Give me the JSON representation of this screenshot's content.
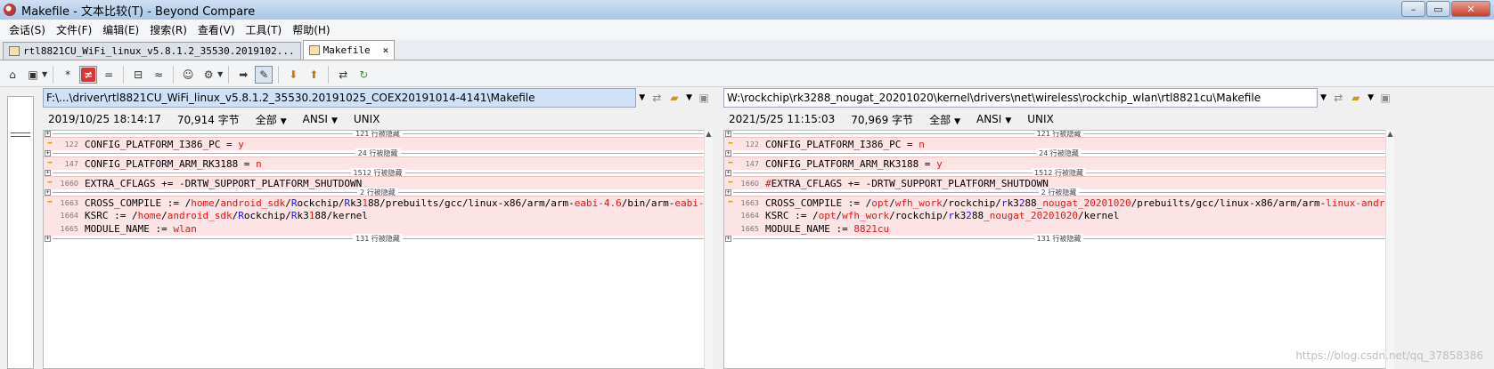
{
  "window": {
    "title": "Makefile - 文本比较(T) - Beyond Compare",
    "controls": {
      "minimize": "–",
      "maximize": "▭",
      "close": "✕"
    }
  },
  "menu": [
    "会话(S)",
    "文件(F)",
    "编辑(E)",
    "搜索(R)",
    "查看(V)",
    "工具(T)",
    "帮助(H)"
  ],
  "tabs": [
    {
      "label": "rtl8821CU_WiFi_linux_v5.8.1.2_35530.2019102...",
      "active": false
    },
    {
      "label": "Makefile",
      "active": true,
      "close": "×"
    }
  ],
  "toolbar": {
    "icons": [
      "home-icon",
      "briefcase-icon",
      "star-icon",
      "not-equal-icon",
      "equal-icon",
      "minor-diff-icon",
      "approx-icon",
      "user-icon",
      "rules-icon",
      "next-icon",
      "edit-icon",
      "down-arrow-icon",
      "up-arrow-icon",
      "swap-icon",
      "refresh-icon"
    ],
    "glyphs": {
      "home": "⌂",
      "briefcase": "▣",
      "star": "*",
      "neq": "≠",
      "eq": "=",
      "minor": "⊟",
      "approx": "≈",
      "user": "☺",
      "rules": "⚙",
      "next": "➡",
      "edit": "✎",
      "down": "⬇",
      "up": "⬆",
      "swap": "⇄",
      "refresh": "↻",
      "drop": "▼"
    }
  },
  "left": {
    "path": "F:\\...\\driver\\rtl8821CU_WiFi_linux_v5.8.1.2_35530.20191025_COEX20191014-4141\\Makefile",
    "date": "2019/10/25 18:14:17",
    "size": "70,914 字节",
    "lines_opt": "全部",
    "encoding": "ANSI",
    "eol": "UNIX"
  },
  "right": {
    "path": "W:\\rockchip\\rk3288_nougat_20201020\\kernel\\drivers\\net\\wireless\\rockchip_wlan\\rtl8821cu\\Makefile",
    "date": "2021/5/25 11:15:03",
    "size": "70,969 字节",
    "lines_opt": "全部",
    "encoding": "ANSI",
    "eol": "UNIX"
  },
  "separators": [
    "121 行被隐藏",
    "24 行被隐藏",
    "1512 行被隐藏",
    "2 行被隐藏",
    "131 行被隐藏"
  ],
  "lines": {
    "l122": "122",
    "l147": "147",
    "l1660": "1660",
    "l1663": "1663",
    "l1664": "1664",
    "l1665": "1665",
    "left": {
      "c122a": "CONFIG_PLATFORM_I386_PC = ",
      "c122b": "y",
      "c147a": "CONFIG_PLATFORM_ARM_RK3188 = ",
      "c147b": "n",
      "c1660": "EXTRA_CFLAGS += -DRTW_SUPPORT_PLATFORM_SHUTDOWN",
      "c1663a": "CROSS_COMPILE := /",
      "c1663b": "home",
      "c1663c": "/",
      "c1663d": "android_sdk",
      "c1663e": "/",
      "c1663f": "R",
      "c1663g": "ockchip/",
      "c1663h": "R",
      "c1663i": "k3",
      "c1663j": "1",
      "c1663k": "88/prebuilts/gcc/linux-x86/arm/arm-",
      "c1663l": "eabi-4.6",
      "c1663m": "/bin/arm-",
      "c1663n": "eabi-",
      "c1664a": "KSRC := /",
      "c1664b": "home",
      "c1664c": "/",
      "c1664d": "android_sdk",
      "c1664e": "/",
      "c1664f": "R",
      "c1664g": "ockchip/",
      "c1664h": "R",
      "c1664i": "k3",
      "c1664j": "1",
      "c1664k": "88/kernel",
      "c1665a": "MODULE_NAME := ",
      "c1665b": "wlan"
    },
    "right": {
      "c122a": "CONFIG_PLATFORM_I386_PC = ",
      "c122b": "n",
      "c147a": "CONFIG_PLATFORM_ARM_RK3188 = ",
      "c147b": "y",
      "c1660a": "#",
      "c1660b": "EXTRA_CFLAGS += -DRTW_SUPPORT_PLATFORM_SHUTDOWN",
      "c1663a": "CROSS_COMPILE := /",
      "c1663b": "opt",
      "c1663c": "/",
      "c1663d": "wfh_work",
      "c1663e": "/rockchip/",
      "c1663f": "r",
      "c1663g": "k3",
      "c1663h": "2",
      "c1663i": "88_",
      "c1663j": "nougat_20201020",
      "c1663k": "/prebuilts/gcc/linux-x86/arm/arm-",
      "c1663l": "linux-andro",
      "c1664a": "KSRC := /",
      "c1664b": "opt",
      "c1664c": "/",
      "c1664d": "wfh_work",
      "c1664e": "/rockchip/",
      "c1664f": "r",
      "c1664g": "k3",
      "c1664h": "2",
      "c1664i": "88_",
      "c1664j": "nougat_20201020",
      "c1664k": "/kernel",
      "c1665a": "MODULE_NAME := ",
      "c1665b": "8821cu"
    }
  },
  "watermark": "https://blog.csdn.net/qq_37858386"
}
